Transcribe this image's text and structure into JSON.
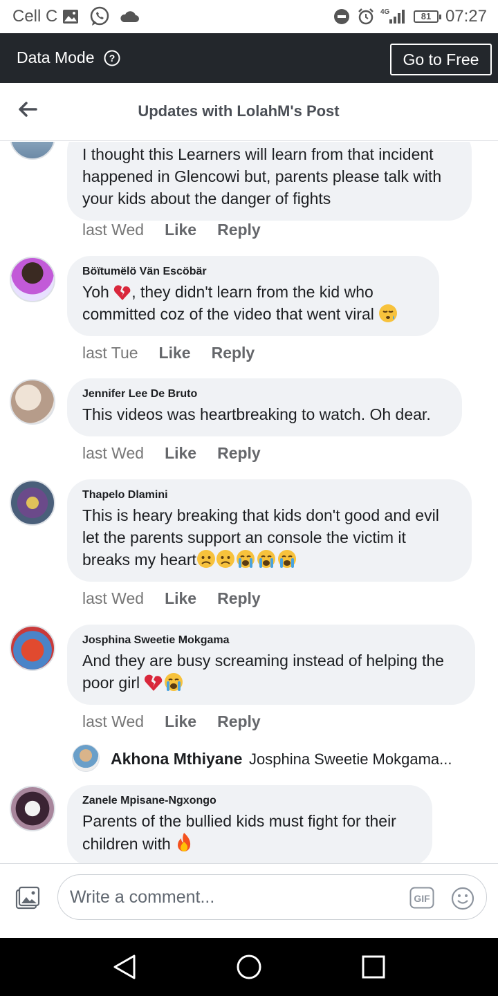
{
  "status_bar": {
    "carrier": "Cell C",
    "network": "4G",
    "battery": "81",
    "time": "07:27"
  },
  "data_bar": {
    "label": "Data Mode",
    "button": "Go to Free"
  },
  "header": {
    "title": "Updates with LolahM's Post"
  },
  "comments": [
    {
      "name": "",
      "text": "I thought this Learners will learn from that incident happened in Glencowi but, parents please talk with your kids about the danger of fights",
      "time": "last Wed",
      "like": "Like",
      "reply": "Reply"
    },
    {
      "name": "Böïtumëlö Vän Escöbär",
      "text_before": "Yoh ",
      "text_middle": ", they didn't learn from the kid who committed coz of the video that went viral ",
      "time": "last Tue",
      "like": "Like",
      "reply": "Reply"
    },
    {
      "name": "Jennifer Lee De Bruto",
      "text": "This videos was heartbreaking to watch. Oh dear.",
      "time": "last Wed",
      "like": "Like",
      "reply": "Reply"
    },
    {
      "name": "Thapelo Dlamini",
      "text": "This is heary breaking that kids don't good and evil let the parents support an console the victim it breaks my heart",
      "time": "last Wed",
      "like": "Like",
      "reply": "Reply"
    },
    {
      "name": "Josphina Sweetie Mokgama",
      "text": "And they are busy screaming instead of helping the poor girl ",
      "time": "last Wed",
      "like": "Like",
      "reply": "Reply"
    },
    {
      "name": "Zanele Mpisane-Ngxongo",
      "text": "Parents of the bullied kids must fight for their children with "
    }
  ],
  "reply_preview": {
    "name": "Akhona Mthiyane",
    "text": "Josphina Sweetie Mokgama..."
  },
  "composer": {
    "placeholder": "Write a comment..."
  },
  "colors": {
    "data_bar_bg": "#23272c",
    "bubble_bg": "#f0f2f5",
    "muted_text": "#65676b"
  }
}
